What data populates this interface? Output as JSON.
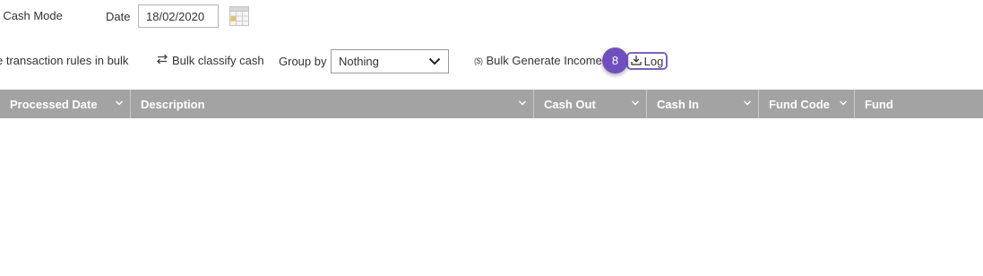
{
  "toolbar": {
    "mode_label": "ll Cash Mode",
    "date_label": "Date",
    "date_value": "18/02/2020",
    "rules_link": "e transaction rules in bulk",
    "bulk_classify": "Bulk classify cash",
    "group_by_label": "Group by",
    "group_by_value": "Nothing",
    "bulk_income": "Bulk Generate Income",
    "money_icon_glyph": "($)",
    "log_label": "Log",
    "step_badge": "8"
  },
  "grid": {
    "columns": [
      {
        "label": "Processed Date"
      },
      {
        "label": "Description"
      },
      {
        "label": "Cash Out"
      },
      {
        "label": "Cash In"
      },
      {
        "label": "Fund Code"
      },
      {
        "label": "Fund"
      }
    ]
  },
  "colors": {
    "header_bg": "#a3a3a3",
    "badge": "#6f4fbf",
    "highlight": "#7a5fd6"
  },
  "icons": [
    "calendar-icon",
    "swap-arrows-icon",
    "chevron-down-icon",
    "money-icon",
    "download-icon"
  ]
}
